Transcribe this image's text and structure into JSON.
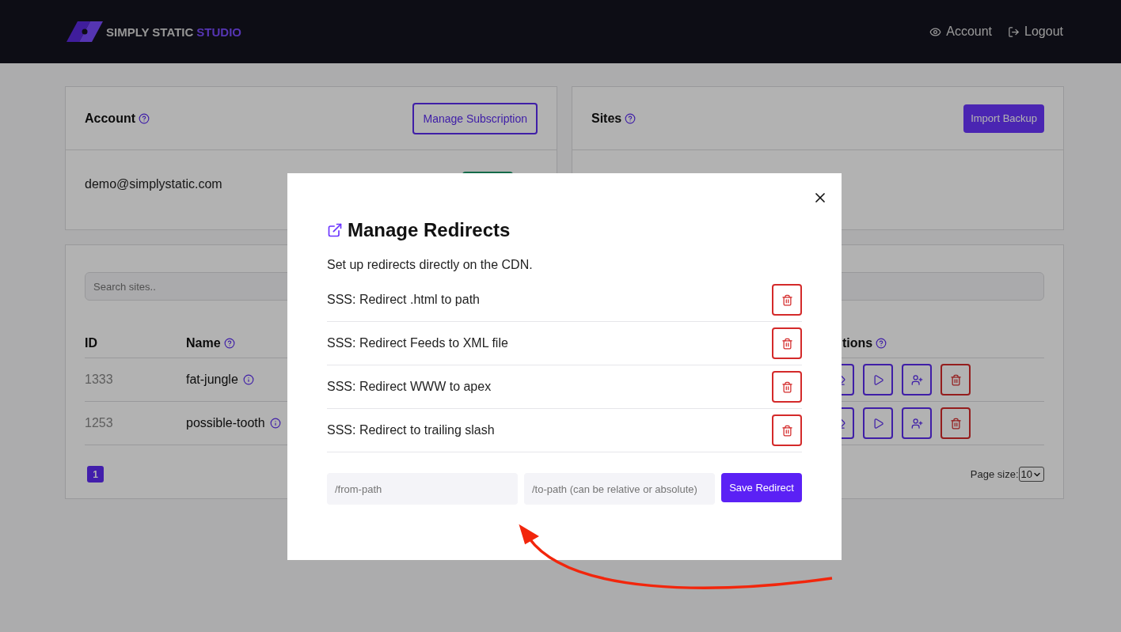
{
  "header": {
    "logo": {
      "primary": "SIMPLY STATIC",
      "accent": "STUDIO"
    },
    "nav": [
      {
        "kind": "eye",
        "label": "Account"
      },
      {
        "kind": "logout",
        "label": "Logout"
      }
    ]
  },
  "account_card": {
    "title": "Account",
    "button": "Manage Subscription",
    "email": "demo@simplystatic.com"
  },
  "sites_card": {
    "title": "Sites",
    "button": "Import Backup"
  },
  "sites_table": {
    "search": {
      "placeholder": "Search sites.."
    },
    "columns": [
      "ID",
      "Name",
      "tions"
    ],
    "rows": [
      {
        "id": "1333",
        "name": "fat-jungle"
      },
      {
        "id": "1253",
        "name": "possible-tooth"
      }
    ],
    "pagination": [
      {
        "label": "1",
        "selected": true
      }
    ],
    "page_size": {
      "label": "Page size:",
      "value": "10"
    }
  },
  "modal": {
    "title": "Manage Redirects",
    "description": "Set up redirects directly on the CDN.",
    "redirects": [
      "SSS: Redirect .html to path",
      "SSS: Redirect Feeds to XML file",
      "SSS: Redirect WWW to apex",
      "SSS: Redirect to trailing slash"
    ],
    "from": {
      "placeholder": "/from-path"
    },
    "to": {
      "placeholder": "/to-path (can be relative or absolute)"
    },
    "save": "Save Redirect"
  }
}
